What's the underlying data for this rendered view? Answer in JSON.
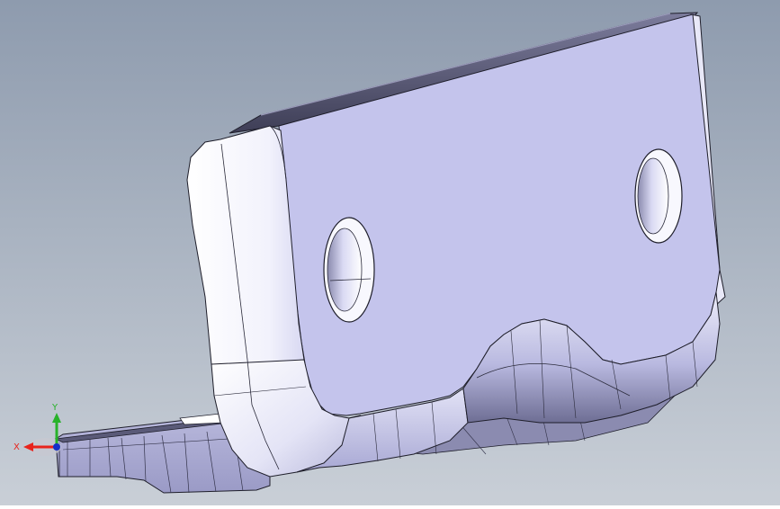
{
  "viewport": {
    "background_top": "#8E9BAE",
    "background_bottom": "#C9CFD7",
    "part_face_color": "#C4C4EC",
    "part_light_color": "#F6F6FE",
    "part_shadow_color": "#5A5A78",
    "edge_color": "#1E1E2A"
  },
  "triad": {
    "x_label": "X",
    "y_label": "Y",
    "x_color": "#E8231C",
    "y_color": "#28B22A",
    "z_color": "#1530C8"
  }
}
